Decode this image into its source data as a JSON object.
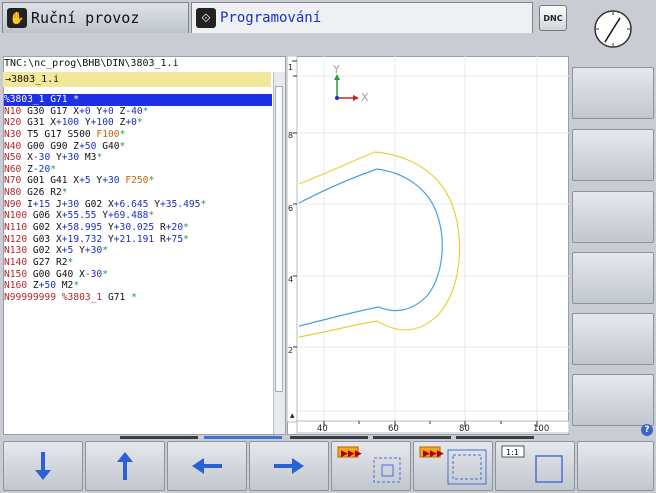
{
  "tabs": {
    "manual_label": "Ruční provoz",
    "programming_label": "Programování"
  },
  "dnc_label": "DNC",
  "program": {
    "path": "TNC:\\nc_prog\\BHB\\DIN\\3803_1.i",
    "file_name": "→3803_1.i",
    "lines": [
      {
        "a": "%3803_1 G71 *",
        "sel": true
      },
      {
        "n": "N10",
        "t": [
          [
            " G30 G17 X",
            ""
          ],
          [
            "+0",
            ""
          ],
          [
            " Y",
            ""
          ],
          [
            "+0",
            ""
          ],
          [
            " Z",
            ""
          ],
          [
            "-40",
            ""
          ],
          [
            "*",
            "mr"
          ]
        ]
      },
      {
        "n": "N20",
        "t": [
          [
            " G31 X",
            ""
          ],
          [
            "+100",
            ""
          ],
          [
            " Y",
            ""
          ],
          [
            "+100",
            ""
          ],
          [
            " Z",
            ""
          ],
          [
            "+0",
            ""
          ],
          [
            "*",
            "mr"
          ]
        ]
      },
      {
        "n": "N30",
        "t": [
          [
            " T5 G17 S500 ",
            ""
          ],
          [
            "F100",
            "of"
          ],
          [
            "*",
            "mr"
          ]
        ]
      },
      {
        "n": "N40",
        "t": [
          [
            " G00 G90 Z",
            ""
          ],
          [
            "+50",
            ""
          ],
          [
            " G40",
            ""
          ],
          [
            "*",
            "mr"
          ]
        ]
      },
      {
        "n": "N50",
        "t": [
          [
            " X",
            ""
          ],
          [
            "-30",
            ""
          ],
          [
            " Y",
            ""
          ],
          [
            "+30",
            ""
          ],
          [
            " M3",
            ""
          ],
          [
            "*",
            "mr"
          ]
        ]
      },
      {
        "n": "N60",
        "t": [
          [
            " Z",
            ""
          ],
          [
            "-20",
            ""
          ],
          [
            "*",
            "mr"
          ]
        ]
      },
      {
        "n": "N70",
        "t": [
          [
            " G01 G41 X",
            ""
          ],
          [
            "+5",
            ""
          ],
          [
            " Y",
            ""
          ],
          [
            "+30",
            ""
          ],
          [
            " ",
            ""
          ],
          [
            "F250",
            "of"
          ],
          [
            "*",
            "mr"
          ]
        ]
      },
      {
        "n": "N80",
        "t": [
          [
            " G26 R2",
            ""
          ],
          [
            "*",
            "mr"
          ]
        ]
      },
      {
        "n": "N90",
        "t": [
          [
            " I",
            ""
          ],
          [
            "+15",
            ""
          ],
          [
            " J",
            ""
          ],
          [
            "+30",
            ""
          ],
          [
            " G02 X",
            ""
          ],
          [
            "+6.645",
            ""
          ],
          [
            " Y",
            ""
          ],
          [
            "+35.495",
            ""
          ],
          [
            "*",
            "mr"
          ]
        ]
      },
      {
        "n": "N100",
        "t": [
          [
            " G06 X",
            ""
          ],
          [
            "+55.55",
            ""
          ],
          [
            " Y",
            ""
          ],
          [
            "+69.488",
            ""
          ],
          [
            "*",
            "mr"
          ]
        ]
      },
      {
        "n": "N110",
        "t": [
          [
            " G02 X",
            ""
          ],
          [
            "+58.995",
            ""
          ],
          [
            " Y",
            ""
          ],
          [
            "+30.025",
            ""
          ],
          [
            " R",
            ""
          ],
          [
            "+20",
            ""
          ],
          [
            "*",
            "mr"
          ]
        ]
      },
      {
        "n": "N120",
        "t": [
          [
            " G03 X",
            ""
          ],
          [
            "+19.732",
            ""
          ],
          [
            " Y",
            ""
          ],
          [
            "+21.191",
            ""
          ],
          [
            " R",
            ""
          ],
          [
            "+75",
            ""
          ],
          [
            "*",
            "mr"
          ]
        ]
      },
      {
        "n": "N130",
        "t": [
          [
            " G02 X",
            ""
          ],
          [
            "+5",
            ""
          ],
          [
            " Y",
            ""
          ],
          [
            "+30",
            ""
          ],
          [
            "*",
            "mr"
          ]
        ]
      },
      {
        "n": "N140",
        "t": [
          [
            " G27 R2",
            ""
          ],
          [
            "*",
            "mr"
          ]
        ]
      },
      {
        "n": "N150",
        "t": [
          [
            " G00 G40 X",
            ""
          ],
          [
            "-30",
            ""
          ],
          [
            "*",
            "mr"
          ]
        ]
      },
      {
        "n": "N160",
        "t": [
          [
            " Z",
            ""
          ],
          [
            "+50",
            ""
          ],
          [
            " M2",
            ""
          ],
          [
            "*",
            "mr"
          ]
        ]
      },
      {
        "n": "N99999999",
        "t": [
          [
            " ",
            ""
          ],
          [
            "%3803_1",
            "nb"
          ],
          [
            " G71 ",
            ""
          ],
          [
            "*",
            "mr"
          ]
        ]
      }
    ]
  },
  "graphic": {
    "axis_y": "Y",
    "axis_x": "X",
    "ruler_bottom": [
      "40",
      "60",
      "80",
      "100"
    ],
    "ruler_left": [
      "1",
      "8",
      "6",
      "4",
      "2"
    ]
  },
  "colors": {
    "selection": "#1d30e6",
    "block_number": "#b2282b",
    "value": "#1a2fc8",
    "feed": "#c86414",
    "tool_path_outer": "#e3d23a",
    "tool_path_inner": "#4aa0e0"
  },
  "softkeys_bottom": [
    "arrow-down-icon",
    "arrow-up-icon",
    "arrow-left-icon",
    "arrow-right-icon",
    "zoom-in-detail-icon",
    "zoom-out-detail-icon",
    "scale-1-1-icon"
  ],
  "scale_label": "1:1"
}
